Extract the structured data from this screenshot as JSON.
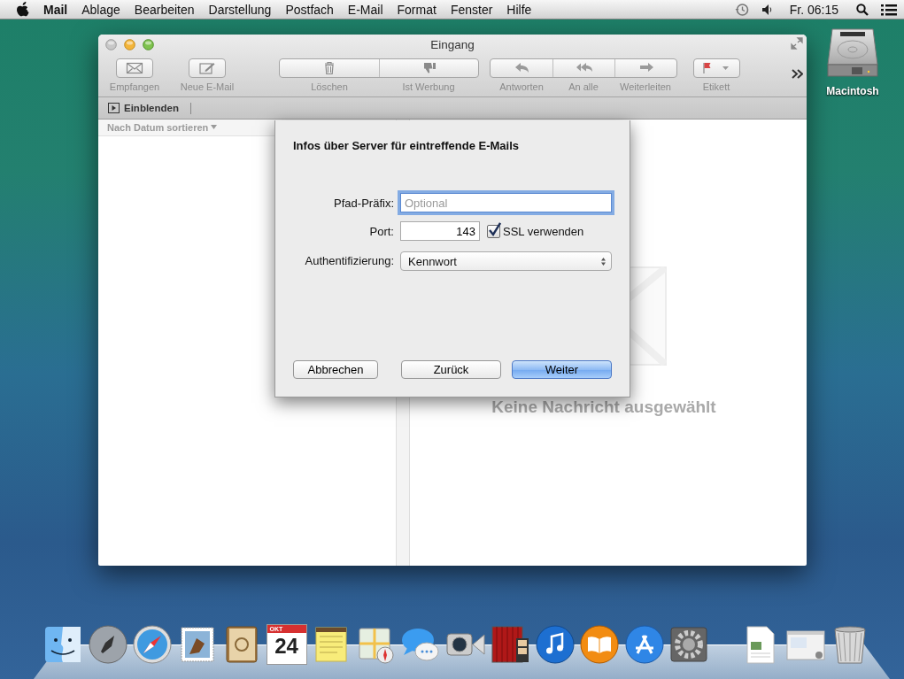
{
  "menu_bar": {
    "app": "Mail",
    "items": [
      "Ablage",
      "Bearbeiten",
      "Darstellung",
      "Postfach",
      "E-Mail",
      "Format",
      "Fenster",
      "Hilfe"
    ],
    "clock": "Fr. 06:15"
  },
  "window": {
    "title": "Eingang",
    "toolbar_groups": [
      {
        "buttons": [
          {
            "label": "Empfangen"
          }
        ]
      },
      {
        "buttons": [
          {
            "label": "Neue E-Mail"
          }
        ]
      },
      {
        "buttons": [
          {
            "label": "Löschen"
          },
          {
            "label": "Ist Werbung"
          }
        ]
      },
      {
        "buttons": [
          {
            "label": "Antworten"
          },
          {
            "label": "An alle"
          },
          {
            "label": "Weiterleiten"
          }
        ]
      },
      {
        "buttons": [
          {
            "label": "Etikett"
          }
        ]
      }
    ],
    "favorites_bar": {
      "button": "Einblenden"
    },
    "message_list": {
      "sort": "Nach Datum sortieren"
    },
    "viewer": {
      "empty_message": "Keine Nachricht ausgewählt"
    }
  },
  "dialog": {
    "title": "Infos über Server für eintreffende E-Mails",
    "fields": [
      {
        "kind": "text",
        "label": "Pfad-Präfix:",
        "placeholder": "Optional",
        "focused": true
      },
      {
        "kind": "port",
        "label": "Port:",
        "value": "143",
        "checkbox": {
          "label": "SSL verwenden",
          "checked": true
        }
      },
      {
        "kind": "popup",
        "label": "Authentifizierung:",
        "value": "Kennwort"
      }
    ],
    "buttons": [
      {
        "label": "Abbrechen",
        "default": false
      },
      {
        "label": "Zurück",
        "default": false
      },
      {
        "label": "Weiter",
        "default": true
      }
    ]
  },
  "desktop_icons": [
    {
      "label": "Macintosh"
    }
  ],
  "dock": {
    "calendar_month": "OKT",
    "calendar_day": "24"
  }
}
